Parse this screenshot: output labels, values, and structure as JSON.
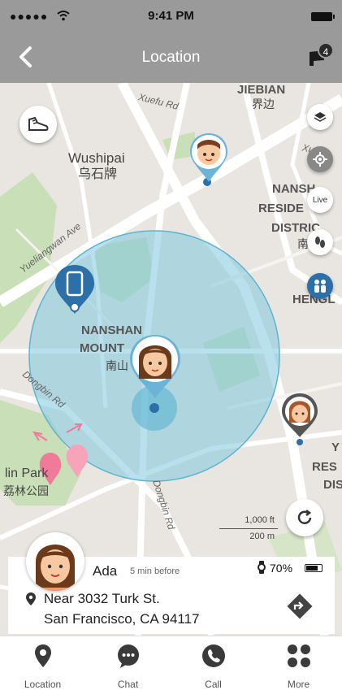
{
  "status_bar": {
    "signal": "●●●●● ",
    "time": "9:41 PM"
  },
  "nav": {
    "title": "Location",
    "message_count": "4"
  },
  "map": {
    "labels": {
      "wushipai_en": "Wushipai",
      "wushipai_cn": "乌石牌",
      "jiebian_en": "JIEBIAN",
      "jiebian_cn": "界边",
      "nanshan_res_1": "NANSH",
      "nanshan_res_2": "RESIDE",
      "nanshan_res_3": "DISTRIC",
      "nanshan_res_cn": "南",
      "henglu": "HENGL",
      "nanshan_mtn_1": "NANSHAN",
      "nanshan_mtn_2": "MOUNT",
      "nanshan_mtn_cn": "南山",
      "lin_park_en": "lin Park",
      "lin_park_cn": "荔林公园",
      "res_right_1": "Y",
      "res_right_2": "RES",
      "res_right_3": "DIS"
    },
    "roads": {
      "xuefu": "Xuefu Rd",
      "xu": "Xu",
      "yueliangwan": "Yueliangwan Ave",
      "dongbin1": "Dongbin Rd",
      "dongbin2": "Dongbin Rd"
    },
    "live_label": "Live",
    "scale_imperial": "1,000 ft",
    "scale_metric": "200 m",
    "circle_color": "#7fc6de",
    "pin_blue": "#2d6fa8",
    "pin_pink": "#f07a9a",
    "pin_dark": "#555555"
  },
  "info": {
    "name": "Ada",
    "time_ago": "5 min before",
    "battery": "70%",
    "address_line1": "Near 3032 Turk St.",
    "address_line2": "San Francisco, CA 94117"
  },
  "tabs": [
    {
      "label": "Location",
      "icon": "location-pin-icon"
    },
    {
      "label": "Chat",
      "icon": "chat-bubble-icon"
    },
    {
      "label": "Call",
      "icon": "phone-icon"
    },
    {
      "label": "More",
      "icon": "grid-icon"
    }
  ]
}
